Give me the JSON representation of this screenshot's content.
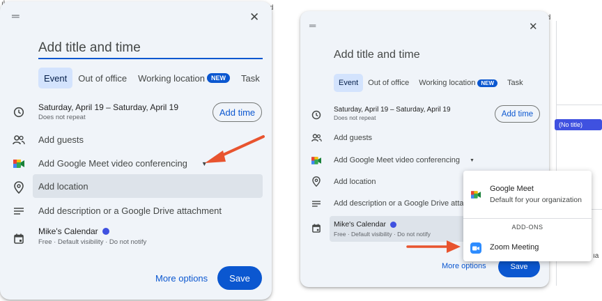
{
  "background": {
    "frag1": "ıl",
    "frag2": "ıd",
    "frag3": "ıd",
    "frag4": "ıa"
  },
  "left": {
    "title_placeholder": "Add title and time",
    "tabs": [
      {
        "label": "Event"
      },
      {
        "label": "Out of office"
      },
      {
        "label": "Working location"
      },
      {
        "label": "Task"
      }
    ],
    "new_badge": "NEW",
    "date_range": "Saturday, April 19  –  Saturday, April 19",
    "repeat": "Does not repeat",
    "add_time": "Add time",
    "guests": "Add guests",
    "meet": "Add Google Meet video conferencing",
    "location": "Add location",
    "description": "Add description or a Google Drive attachment",
    "calendar_name": "Mike's Calendar",
    "calendar_sub": "Free · Default visibility · Do not notify",
    "more_options": "More options",
    "save": "Save"
  },
  "right": {
    "title_placeholder": "Add title and time",
    "tabs": [
      {
        "label": "Event"
      },
      {
        "label": "Out of office"
      },
      {
        "label": "Working location"
      },
      {
        "label": "Task"
      }
    ],
    "new_badge": "NEW",
    "date_range": "Saturday, April 19  –  Saturday, April 19",
    "repeat": "Does not repeat",
    "add_time": "Add time",
    "guests": "Add guests",
    "meet": "Add Google Meet video conferencing",
    "location": "Add location",
    "description": "Add description or a Google Drive atta",
    "calendar_name": "Mike's Calendar",
    "calendar_sub": "Free · Default visibility · Do not notify",
    "more_options": "More options",
    "save": "Save"
  },
  "dropdown": {
    "google_meet_title": "Google Meet",
    "google_meet_sub": "Default for your organization",
    "addons_header": "ADD-ONS",
    "zoom": "Zoom Meeting"
  },
  "chip": "(No title)",
  "colors": {
    "accent": "#0b57d0",
    "arrow": "#e8542f",
    "panel": "#f0f4f9",
    "tab_active": "#d3e3fd",
    "calendar_dot": "#3f51e0"
  },
  "icons": {
    "drag": "drag-handle-icon",
    "close": "close-icon",
    "clock": "clock-icon",
    "people": "people-icon",
    "meet": "google-meet-icon",
    "pin": "location-pin-icon",
    "notes": "description-lines-icon",
    "calendar": "calendar-icon",
    "zoom": "zoom-icon",
    "caret": "caret-down-icon"
  }
}
